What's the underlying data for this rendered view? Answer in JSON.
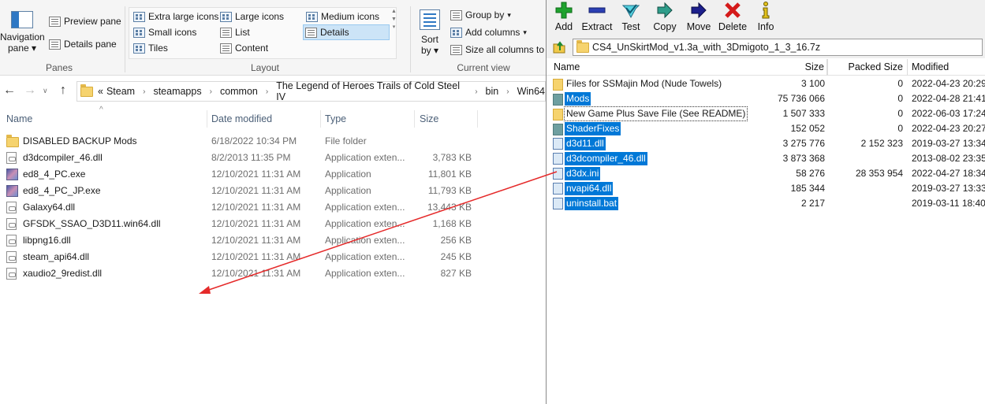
{
  "explorer": {
    "ribbon": {
      "panes": {
        "navigation_pane": "Navigation",
        "navigation_pane_2": "pane",
        "preview_pane": "Preview pane",
        "details_pane": "Details pane",
        "group_label": "Panes"
      },
      "layout": {
        "extra_large_icons": "Extra large icons",
        "large_icons": "Large icons",
        "medium_icons": "Medium icons",
        "small_icons": "Small icons",
        "list": "List",
        "details": "Details",
        "tiles": "Tiles",
        "content": "Content",
        "group_label": "Layout"
      },
      "current_view": {
        "sort_by": "Sort",
        "sort_by_2": "by",
        "group_by": "Group by",
        "add_columns": "Add columns",
        "size_all_columns": "Size all columns to f",
        "group_label": "Current view"
      }
    },
    "address": {
      "overflow": "«",
      "crumbs": [
        "Steam",
        "steamapps",
        "common",
        "The Legend of Heroes Trails of Cold Steel IV",
        "bin",
        "Win64"
      ]
    },
    "columns": {
      "name": "Name",
      "date_modified": "Date modified",
      "type": "Type",
      "size": "Size"
    },
    "files": [
      {
        "name": "DISABLED BACKUP Mods",
        "date": "6/18/2022 10:34 PM",
        "type": "File folder",
        "size": "",
        "icon": "folder-icon"
      },
      {
        "name": "d3dcompiler_46.dll",
        "date": "8/2/2013 11:35 PM",
        "type": "Application exten...",
        "size": "3,783 KB",
        "icon": "dll-file-icon"
      },
      {
        "name": "ed8_4_PC.exe",
        "date": "12/10/2021 11:31 AM",
        "type": "Application",
        "size": "11,801 KB",
        "icon": "exe-file-icon"
      },
      {
        "name": "ed8_4_PC_JP.exe",
        "date": "12/10/2021 11:31 AM",
        "type": "Application",
        "size": "11,793 KB",
        "icon": "exe-file-icon"
      },
      {
        "name": "Galaxy64.dll",
        "date": "12/10/2021 11:31 AM",
        "type": "Application exten...",
        "size": "13,443 KB",
        "icon": "dll-file-icon"
      },
      {
        "name": "GFSDK_SSAO_D3D11.win64.dll",
        "date": "12/10/2021 11:31 AM",
        "type": "Application exten...",
        "size": "1,168 KB",
        "icon": "dll-file-icon"
      },
      {
        "name": "libpng16.dll",
        "date": "12/10/2021 11:31 AM",
        "type": "Application exten...",
        "size": "256 KB",
        "icon": "dll-file-icon"
      },
      {
        "name": "steam_api64.dll",
        "date": "12/10/2021 11:31 AM",
        "type": "Application exten...",
        "size": "245 KB",
        "icon": "dll-file-icon"
      },
      {
        "name": "xaudio2_9redist.dll",
        "date": "12/10/2021 11:31 AM",
        "type": "Application exten...",
        "size": "827 KB",
        "icon": "dll-file-icon"
      }
    ]
  },
  "zip": {
    "toolbar": [
      "Add",
      "Extract",
      "Test",
      "Copy",
      "Move",
      "Delete",
      "Info"
    ],
    "path": "CS4_UnSkirtMod_v1.3a_with_3Dmigoto_1_3_16.7z",
    "columns": {
      "name": "Name",
      "size": "Size",
      "packed_size": "Packed Size",
      "modified": "Modified"
    },
    "items": [
      {
        "name": "Files for SSMajin Mod (Nude Towels)",
        "size": "3 100",
        "packed": "0",
        "modified": "2022-04-23 20:29",
        "kind": "folder",
        "selected": false
      },
      {
        "name": "Mods",
        "size": "75 736 066",
        "packed": "0",
        "modified": "2022-04-28 21:41",
        "kind": "dir",
        "selected": true
      },
      {
        "name": "New Game Plus Save File (See README)",
        "size": "1 507 333",
        "packed": "0",
        "modified": "2022-06-03 17:24",
        "kind": "folder",
        "selected": false,
        "focus": true
      },
      {
        "name": "ShaderFixes",
        "size": "152 052",
        "packed": "0",
        "modified": "2022-04-23 20:27",
        "kind": "dir",
        "selected": true
      },
      {
        "name": "d3d11.dll",
        "size": "3 275 776",
        "packed": "2 152 323",
        "modified": "2019-03-27 13:34",
        "kind": "file",
        "selected": true
      },
      {
        "name": "d3dcompiler_46.dll",
        "size": "3 873 368",
        "packed": "",
        "modified": "2013-08-02 23:35",
        "kind": "file",
        "selected": true
      },
      {
        "name": "d3dx.ini",
        "size": "58 276",
        "packed": "28 353 954",
        "modified": "2022-04-27 18:34",
        "kind": "file",
        "selected": true
      },
      {
        "name": "nvapi64.dll",
        "size": "185 344",
        "packed": "",
        "modified": "2019-03-27 13:33",
        "kind": "file",
        "selected": true
      },
      {
        "name": "uninstall.bat",
        "size": "2 217",
        "packed": "",
        "modified": "2019-03-11 18:40",
        "kind": "file",
        "selected": true
      }
    ]
  },
  "colors": {
    "selection": "#0078d7",
    "arrow": "#e52a2a",
    "folder": "#f6d36e"
  }
}
